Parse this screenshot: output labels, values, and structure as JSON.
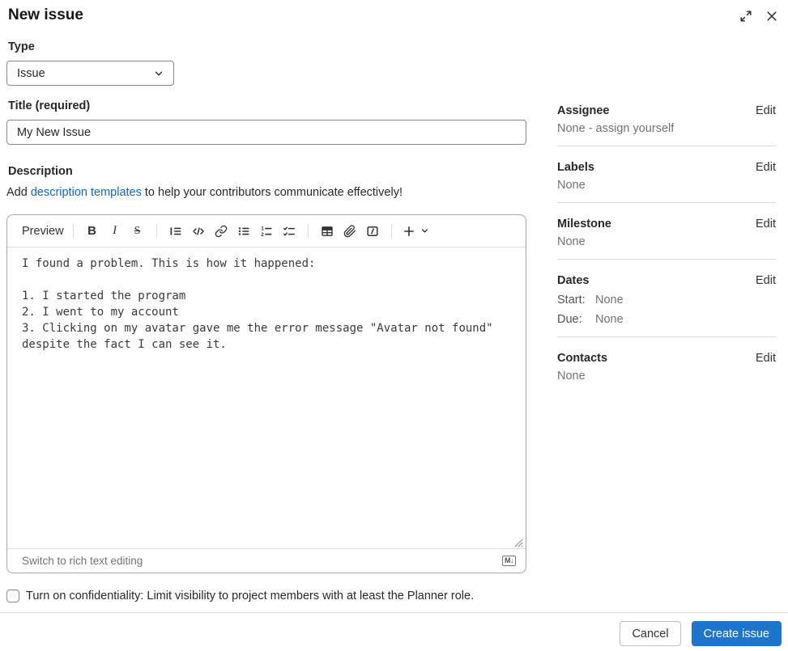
{
  "header": {
    "title": "New issue",
    "icons": [
      "maximize-icon",
      "close-icon"
    ]
  },
  "type_section": {
    "label": "Type",
    "selected_option": "Issue"
  },
  "title_section": {
    "label": "Title (required)",
    "value": "My New Issue"
  },
  "description_section": {
    "label": "Description",
    "helper_prefix": "Add ",
    "helper_link": "description templates",
    "helper_suffix": " to help your contributors communicate effectively!",
    "editor": {
      "preview_label": "Preview",
      "toolbar_icons": [
        "bold",
        "italic",
        "strikethrough",
        "quote",
        "code",
        "link",
        "bulleted-list",
        "ordered-list",
        "task-list",
        "table",
        "attach-file",
        "collapsible-section",
        "more-options"
      ],
      "content": "I found a problem. This is how it happened:\n\n1. I started the program\n2. I went to my account\n3. Clicking on my avatar gave me the error message \"Avatar not found\"\ndespite the fact I can see it.",
      "switch_label": "Switch to rich text editing",
      "markdown_badge": "M↓"
    }
  },
  "confidentiality": {
    "label": "Turn on confidentiality: Limit visibility to project members with at least the Planner role.",
    "checked": false
  },
  "sidebar": {
    "sections": [
      {
        "label": "Assignee",
        "action": "Edit",
        "value": "None - assign yourself"
      },
      {
        "label": "Labels",
        "action": "Edit",
        "value": "None"
      },
      {
        "label": "Milestone",
        "action": "Edit",
        "value": "None"
      },
      {
        "label": "Dates",
        "action": "Edit",
        "rows": [
          {
            "key": "Start:",
            "value": "None"
          },
          {
            "key": "Due:",
            "value": "None"
          }
        ]
      },
      {
        "label": "Contacts",
        "action": "Edit",
        "value": "None"
      }
    ]
  },
  "footer": {
    "cancel_label": "Cancel",
    "submit_label": "Create issue"
  },
  "colors": {
    "primary_button": "#1f75cb",
    "link_blue": "#1068bf",
    "secondary_text": "#737278",
    "divider": "#dcdcde"
  }
}
